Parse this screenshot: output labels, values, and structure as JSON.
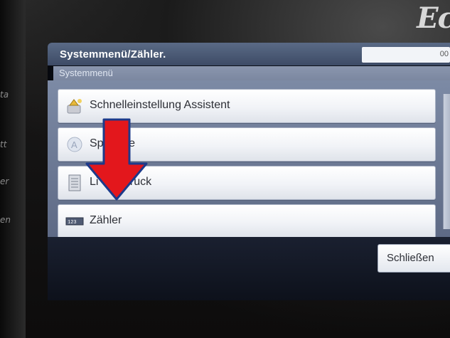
{
  "device": {
    "brand_text": "Ec",
    "left_labels": [
      "ta",
      "tt",
      "er",
      "en"
    ]
  },
  "header": {
    "title": "Systemmenü/Zähler.",
    "status_value": "00"
  },
  "subheader": {
    "title": "Systemmenü"
  },
  "menu": {
    "items": [
      {
        "label": "Schnelleinstellung Assistent",
        "icon": "wizard-icon"
      },
      {
        "label": "Sp        e",
        "icon": "language-icon"
      },
      {
        "label": "Li          ruck",
        "icon": "list-print-icon"
      },
      {
        "label": "Zähler",
        "icon": "counter-icon"
      }
    ]
  },
  "footer": {
    "close_label": "Schließen"
  },
  "overlay": {
    "arrow_color": "#e3171c",
    "arrow_outline": "#1d3a8a"
  },
  "colors": {
    "title_bar": "#3d4b66",
    "panel": "#6d7a96",
    "item_bg": "#f1f3f7"
  }
}
